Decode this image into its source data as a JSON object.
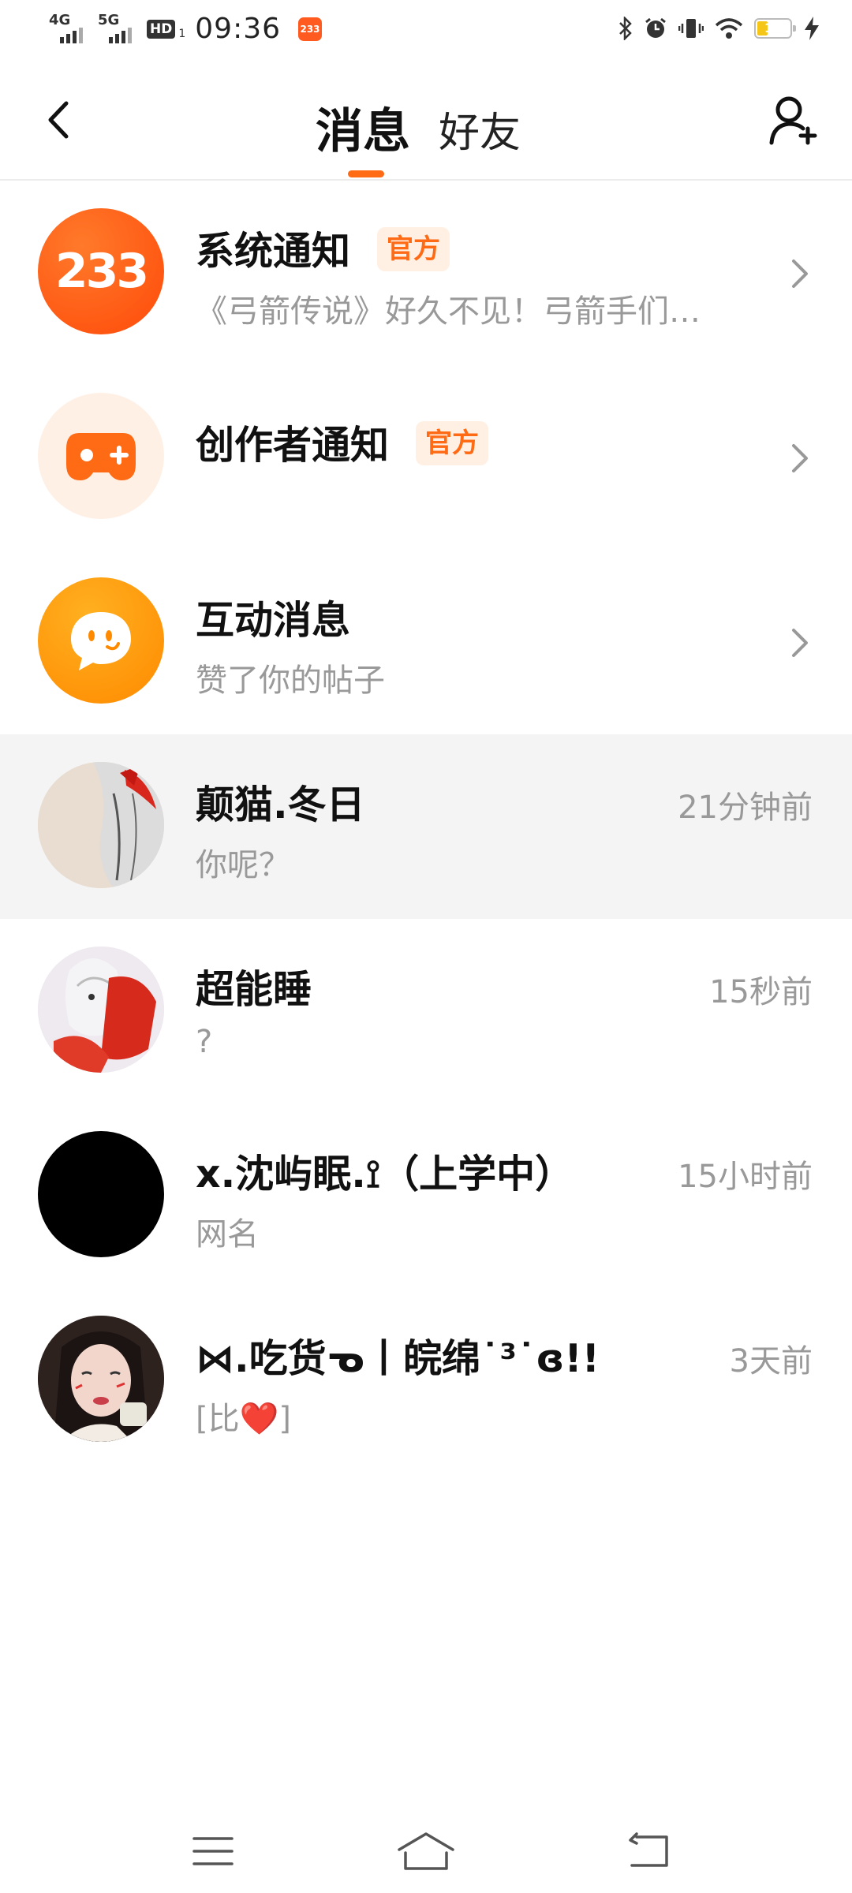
{
  "status_bar": {
    "signal1_label": "4G",
    "signal2_label": "5G",
    "hd_label": "HD",
    "hd_sub": "1",
    "time": "09:36",
    "app_badge": "233",
    "battery": "18"
  },
  "header": {
    "tab_messages": "消息",
    "tab_friends": "好友"
  },
  "list": {
    "items": [
      {
        "name": "系统通知",
        "badge": "官方",
        "subtitle": "《弓箭传说》好久不见！弓箭手们…",
        "avatar_text": "233"
      },
      {
        "name": "创作者通知",
        "badge": "官方",
        "subtitle": ""
      },
      {
        "name": "互动消息",
        "subtitle": "赞了你的帖子"
      },
      {
        "name": "颠猫.冬日",
        "subtitle": "你呢？",
        "time": "21分钟前"
      },
      {
        "name": "超能睡",
        "subtitle": "?",
        "time": "15秒前"
      },
      {
        "name": "x.沈屿眠.⟟（上学中）",
        "subtitle": "网名",
        "time": "15小时前"
      },
      {
        "name": "⋈.吃货ᓀ丨皖绵˙³˙ɞ!!",
        "subtitle": "[比❤️]",
        "time": "3天前"
      }
    ]
  },
  "colors": {
    "accent": "#ff6a14",
    "badge_bg": "#fff0e3",
    "highlight_row": "#f4f4f4",
    "muted_text": "#999999"
  },
  "icons": {
    "back": "back-arrow-icon",
    "add_friend": "add-friend-icon",
    "chevron": "chevron-right-icon",
    "nav_menu": "menu-icon",
    "nav_home": "home-icon",
    "nav_back": "return-icon"
  }
}
